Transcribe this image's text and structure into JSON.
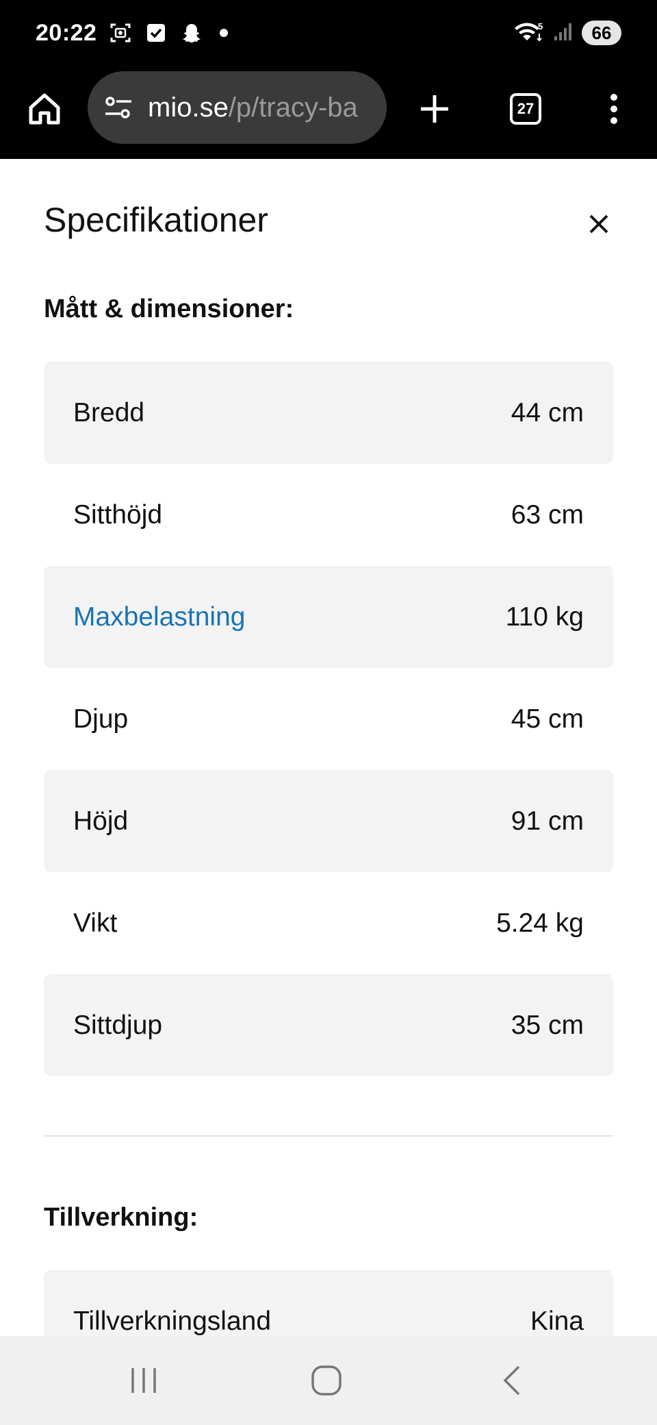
{
  "status_bar": {
    "time": "20:22",
    "icons": [
      "screenshot-icon",
      "checkbox-icon",
      "snapchat-icon",
      "notification-dot-icon"
    ],
    "right_icons": [
      "wifi-icon",
      "signal-icon"
    ],
    "wifi_badge": "5",
    "battery": "66"
  },
  "browser": {
    "url_domain": "mio.se",
    "url_path": "/p/tracy-ba",
    "tab_count": "27"
  },
  "panel": {
    "title": "Specifikationer",
    "sections": [
      {
        "title": "Mått & dimensioner:",
        "rows": [
          {
            "label": "Bredd",
            "value": "44 cm"
          },
          {
            "label": "Sitthöjd",
            "value": "63 cm"
          },
          {
            "label": "Maxbelastning",
            "value": "110 kg"
          },
          {
            "label": "Djup",
            "value": "45 cm"
          },
          {
            "label": "Höjd",
            "value": "91 cm"
          },
          {
            "label": "Vikt",
            "value": "5.24 kg"
          },
          {
            "label": "Sittdjup",
            "value": "35 cm"
          }
        ]
      },
      {
        "title": "Tillverkning:",
        "rows": [
          {
            "label": "Tillverkningsland",
            "value": "Kina"
          }
        ]
      }
    ]
  },
  "colors": {
    "link": "#1a73b5",
    "row_shade": "#f3f3f3",
    "toolbar": "#000000",
    "url_box": "#3a3a3a",
    "nav_bar": "#f0f0f0"
  },
  "nav_bar": {
    "icons": [
      "recent-apps-icon",
      "home-circle-icon",
      "back-icon"
    ]
  }
}
